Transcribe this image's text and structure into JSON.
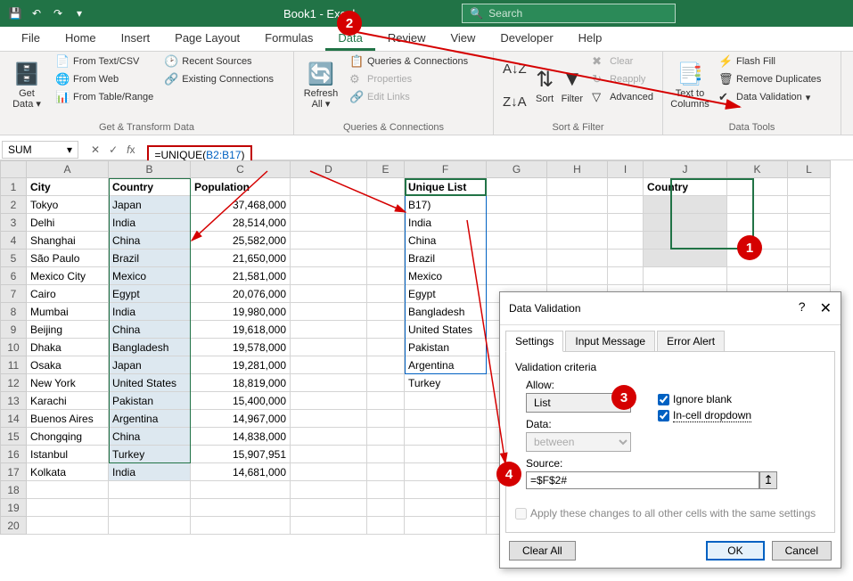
{
  "titlebar": {
    "title": "Book1 - Excel",
    "search_placeholder": "Search"
  },
  "tabs": [
    "File",
    "Home",
    "Insert",
    "Page Layout",
    "Formulas",
    "Data",
    "Review",
    "View",
    "Developer",
    "Help"
  ],
  "active_tab": "Data",
  "ribbon": {
    "get_data": {
      "label": "Get Data",
      "items": [
        "From Text/CSV",
        "From Web",
        "From Table/Range",
        "Recent Sources",
        "Existing Connections"
      ],
      "group": "Get & Transform Data"
    },
    "refresh": {
      "label": "Refresh All",
      "items": [
        "Queries & Connections",
        "Properties",
        "Edit Links"
      ],
      "group": "Queries & Connections"
    },
    "sort": {
      "sort": "Sort",
      "filter": "Filter",
      "clear": "Clear",
      "reapply": "Reapply",
      "advanced": "Advanced",
      "group": "Sort & Filter"
    },
    "text_to_cols": {
      "label": "Text to Columns",
      "flash": "Flash Fill",
      "remove": "Remove Duplicates",
      "validation": "Data Validation",
      "group": "Data Tools"
    }
  },
  "name_box": "SUM",
  "formula": "=UNIQUE(B2:B17)",
  "formula_parts": {
    "pre": "=UNIQUE(",
    "ref": "B2:B17",
    "post": ")"
  },
  "columns": [
    "A",
    "B",
    "C",
    "D",
    "E",
    "F",
    "G",
    "H",
    "I",
    "J",
    "K",
    "L"
  ],
  "headers": {
    "A": "City",
    "B": "Country",
    "C": "Population",
    "F": "Unique List",
    "J": "Country"
  },
  "f2_display": "B17)",
  "data_rows": [
    {
      "A": "Tokyo",
      "B": "Japan",
      "C": "37,468,000",
      "F": "B17)"
    },
    {
      "A": "Delhi",
      "B": "India",
      "C": "28,514,000",
      "F": "India"
    },
    {
      "A": "Shanghai",
      "B": "China",
      "C": "25,582,000",
      "F": "China"
    },
    {
      "A": "São Paulo",
      "B": "Brazil",
      "C": "21,650,000",
      "F": "Brazil"
    },
    {
      "A": "Mexico City",
      "B": "Mexico",
      "C": "21,581,000",
      "F": "Mexico"
    },
    {
      "A": "Cairo",
      "B": "Egypt",
      "C": "20,076,000",
      "F": "Egypt"
    },
    {
      "A": "Mumbai",
      "B": "India",
      "C": "19,980,000",
      "F": "Bangladesh"
    },
    {
      "A": "Beijing",
      "B": "China",
      "C": "19,618,000",
      "F": "United States"
    },
    {
      "A": "Dhaka",
      "B": "Bangladesh",
      "C": "19,578,000",
      "F": "Pakistan"
    },
    {
      "A": "Osaka",
      "B": "Japan",
      "C": "19,281,000",
      "F": "Argentina"
    },
    {
      "A": "New York",
      "B": "United States",
      "C": "18,819,000",
      "F": "Turkey"
    },
    {
      "A": "Karachi",
      "B": "Pakistan",
      "C": "15,400,000",
      "F": ""
    },
    {
      "A": "Buenos Aires",
      "B": "Argentina",
      "C": "14,967,000",
      "F": ""
    },
    {
      "A": "Chongqing",
      "B": "China",
      "C": "14,838,000",
      "F": ""
    },
    {
      "A": "Istanbul",
      "B": "Turkey",
      "C": "15,907,951",
      "F": ""
    },
    {
      "A": "Kolkata",
      "B": "India",
      "C": "14,681,000",
      "F": ""
    }
  ],
  "dialog": {
    "title": "Data Validation",
    "tabs": [
      "Settings",
      "Input Message",
      "Error Alert"
    ],
    "criteria_label": "Validation criteria",
    "allow_label": "Allow:",
    "allow_value": "List",
    "data_label": "Data:",
    "data_value": "between",
    "source_label": "Source:",
    "source_value": "=$F$2#",
    "ignore_blank": "Ignore blank",
    "incell_dropdown": "In-cell dropdown",
    "apply_all": "Apply these changes to all other cells with the same settings",
    "clear": "Clear All",
    "ok": "OK",
    "cancel": "Cancel"
  },
  "annotations": {
    "1": "1",
    "2": "2",
    "3": "3",
    "4": "4"
  }
}
